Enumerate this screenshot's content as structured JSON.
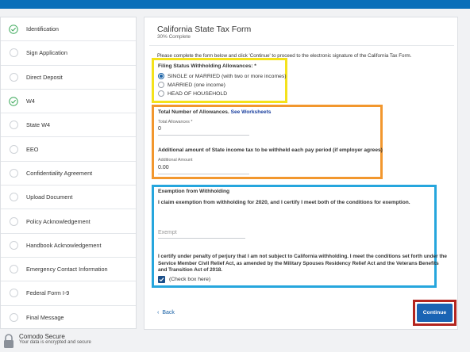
{
  "colors": {
    "topbar": "#0a6fb9",
    "accent": "#1a64b4",
    "check": "#3ca95a",
    "highlight_yellow": "#f4e21b",
    "highlight_orange": "#f2972e",
    "highlight_blue": "#26a6dd",
    "highlight_red": "#b3251f"
  },
  "sidebar": {
    "items": [
      {
        "label": "Identification",
        "status": "complete",
        "icon": "check-circle-icon"
      },
      {
        "label": "Sign Application",
        "status": "pending",
        "icon": "empty-circle-icon"
      },
      {
        "label": "Direct Deposit",
        "status": "pending",
        "icon": "empty-circle-icon"
      },
      {
        "label": "W4",
        "status": "complete",
        "icon": "check-circle-icon"
      },
      {
        "label": "State W4",
        "status": "pending",
        "icon": "empty-circle-icon"
      },
      {
        "label": "EEO",
        "status": "pending",
        "icon": "empty-circle-icon"
      },
      {
        "label": "Confidentiality Agreement",
        "status": "pending",
        "icon": "empty-circle-icon"
      },
      {
        "label": "Upload Document",
        "status": "pending",
        "icon": "empty-circle-icon"
      },
      {
        "label": "Policy Acknowledgement",
        "status": "pending",
        "icon": "empty-circle-icon"
      },
      {
        "label": "Handbook Acknowledgement",
        "status": "pending",
        "icon": "empty-circle-icon"
      },
      {
        "label": "Emergency Contact Information",
        "status": "pending",
        "icon": "empty-circle-icon"
      },
      {
        "label": "Federal Form I-9",
        "status": "pending",
        "icon": "empty-circle-icon"
      },
      {
        "label": "Final Message",
        "status": "pending",
        "icon": "empty-circle-icon"
      }
    ]
  },
  "secure": {
    "title": "Comodo Secure",
    "subtitle": "Your data is encrypted and secure",
    "icon": "lock-icon"
  },
  "form": {
    "title": "California State Tax Form",
    "progress": "30% Complete",
    "progress_value": 30,
    "intro": "Please complete the form below and click 'Continue' to proceed to the electronic signature of the California Tax Form.",
    "filing_status": {
      "label": "Filing Status Withholding Allowances: *",
      "options": [
        {
          "label": "SINGLE or MARRIED (with two or more incomes)",
          "selected": true
        },
        {
          "label": "MARRIED (one income)",
          "selected": false
        },
        {
          "label": "HEAD OF HOUSEHOLD",
          "selected": false
        }
      ]
    },
    "allowances": {
      "heading": "Total Number of Allowances.",
      "link": "See Worksheets",
      "field_label": "Total Allowances *",
      "value": "0",
      "additional_heading": "Additional amount of State income tax to be withheld each pay period (if employer agrees)",
      "additional_label": "Additional Amount",
      "additional_value": "0.00"
    },
    "exemption": {
      "heading": "Exemption from Withholding",
      "claim": "I claim exemption from withholding for 2020, and I certify I meet both of the conditions for exemption.",
      "placeholder": "Exempt",
      "perjury": "I certify under penalty of perjury that I am not subject to California withholding. I meet the conditions set forth under the Service Member Civil Relief Act, as amended by the Military Spouses Residency Relief Act and the Veterans Benefits and Transition Act of 2018.",
      "checkbox_label": "(Check box here)",
      "checked": true
    },
    "back_label": "Back",
    "continue_label": "Continue"
  }
}
